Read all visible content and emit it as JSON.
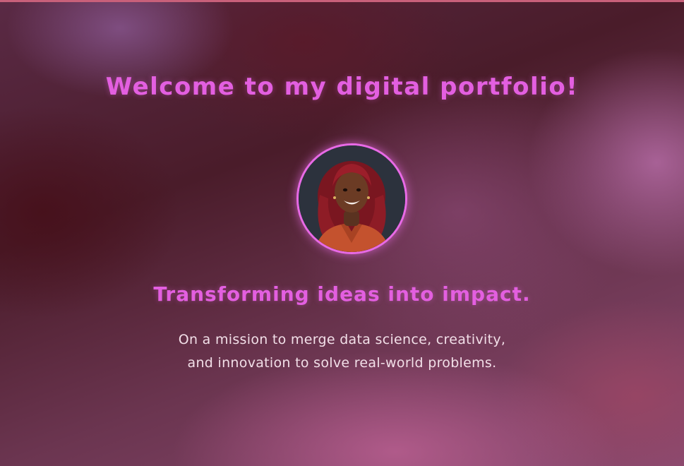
{
  "hero": {
    "welcome_title": "Welcome to my digital portfolio!",
    "tagline": "Transforming ideas into impact.",
    "mission_line_1": "On a mission to merge data science, creativity,",
    "mission_line_2": "and innovation to solve real-world problems."
  },
  "colors": {
    "accent": "#e35fe0",
    "body_text": "#f2dfe8",
    "top_border": "#c8607a"
  }
}
